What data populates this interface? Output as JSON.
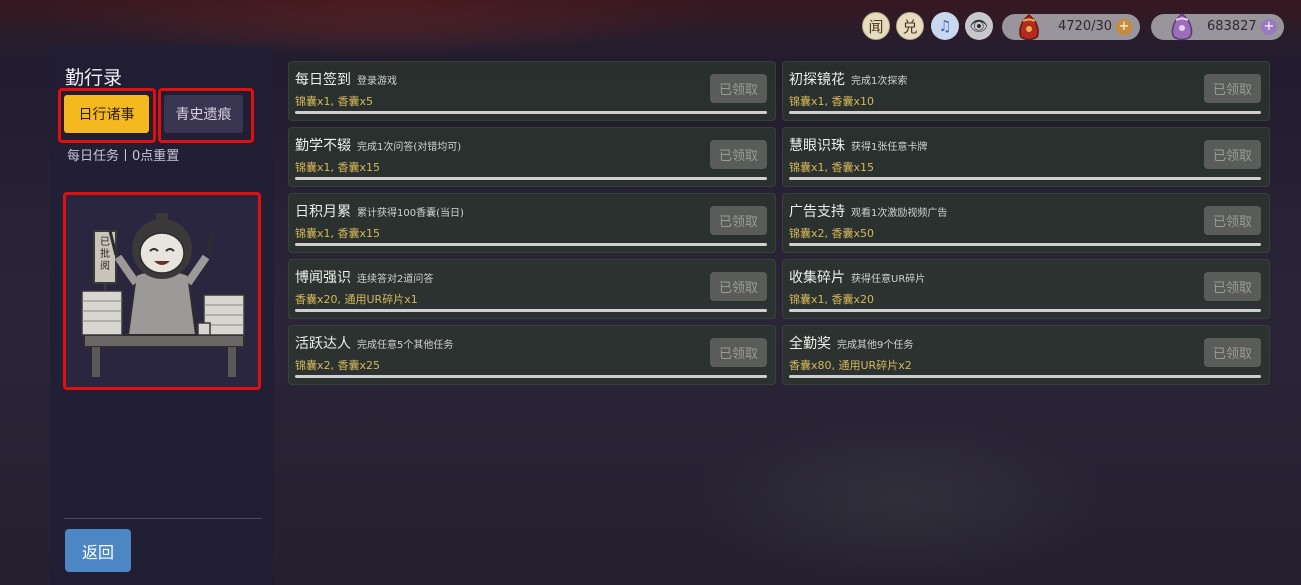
{
  "hud": {
    "icons": [
      {
        "name": "news-icon",
        "glyph": "闻"
      },
      {
        "name": "redeem-icon",
        "glyph": "兑"
      },
      {
        "name": "music-icon",
        "glyph": "♫"
      },
      {
        "name": "eye-icon",
        "glyph": "👁"
      }
    ],
    "fragrance_value": "4720/30",
    "gem_value": "683827"
  },
  "sidebar": {
    "title": "勤行录",
    "tabs": [
      {
        "label": "日行诸事",
        "active": true
      },
      {
        "label": "青史遗痕",
        "active": false
      }
    ],
    "subtitle": "每日任务丨0点重置",
    "portrait_sign": "已批阅",
    "back_label": "返回"
  },
  "tasks": [
    {
      "name": "每日签到",
      "desc": "登录游戏",
      "reward": "锦囊x1, 香囊x5",
      "claim": "已领取"
    },
    {
      "name": "初探镜花",
      "desc": "完成1次探索",
      "reward": "锦囊x1, 香囊x10",
      "claim": "已领取"
    },
    {
      "name": "勤学不辍",
      "desc": "完成1次问答(对错均可)",
      "reward": "锦囊x1, 香囊x15",
      "claim": "已领取"
    },
    {
      "name": "慧眼识珠",
      "desc": "获得1张任意卡牌",
      "reward": "锦囊x1, 香囊x15",
      "claim": "已领取"
    },
    {
      "name": "日积月累",
      "desc": "累计获得100香囊(当日)",
      "reward": "锦囊x1, 香囊x15",
      "claim": "已领取"
    },
    {
      "name": "广告支持",
      "desc": "观看1次激励视频广告",
      "reward": "锦囊x2, 香囊x50",
      "claim": "已领取"
    },
    {
      "name": "博闻强识",
      "desc": "连续答对2道问答",
      "reward": "香囊x20, 通用UR碎片x1",
      "claim": "已领取"
    },
    {
      "name": "收集碎片",
      "desc": "获得任意UR碎片",
      "reward": "锦囊x1, 香囊x20",
      "claim": "已领取"
    },
    {
      "name": "活跃达人",
      "desc": "完成任意5个其他任务",
      "reward": "锦囊x2, 香囊x25",
      "claim": "已领取"
    },
    {
      "name": "全勤奖",
      "desc": "完成其他9个任务",
      "reward": "香囊x80, 通用UR碎片x2",
      "claim": "已领取"
    }
  ],
  "colors": {
    "accent_tab": "#f4b91f",
    "reward_text": "#d6b85a",
    "highlight_box": "#e01010",
    "back_button": "#4d86c4"
  }
}
